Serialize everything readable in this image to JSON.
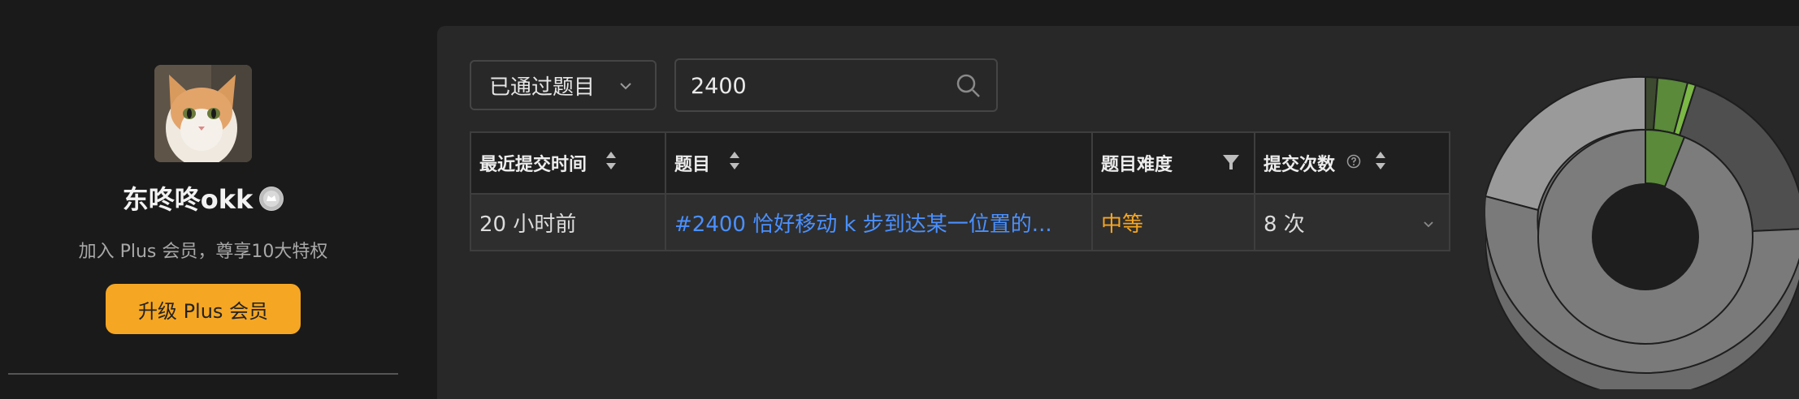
{
  "profile": {
    "username": "东咚咚okk",
    "plus_tip": "加入 Plus 会员，尊享10大特权",
    "upgrade_label": "升级 Plus 会员"
  },
  "filters": {
    "status_select": "已通过题目",
    "search_value": "2400"
  },
  "table": {
    "headers": [
      "最近提交时间",
      "题目",
      "题目难度",
      "提交次数"
    ],
    "rows": [
      {
        "time": "20 小时前",
        "title": "#2400 恰好移动 k 步到达某一位置的...",
        "difficulty": "中等",
        "attempts": "8 次"
      }
    ]
  },
  "colors": {
    "accent": "#f5a623",
    "link": "#4a90ff",
    "medium": "#f5a623",
    "chart_green": "#5a8a3a"
  }
}
